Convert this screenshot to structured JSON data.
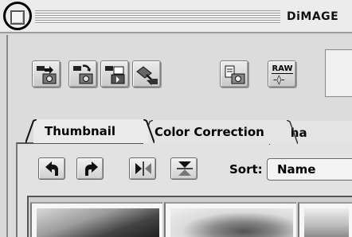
{
  "window": {
    "title": "DiMAGE",
    "close_box_highlighted": true
  },
  "toolbar": {
    "buttons": [
      {
        "icon": "import-scan-icon"
      },
      {
        "icon": "import-camera-icon"
      },
      {
        "icon": "import-folder-icon"
      },
      {
        "icon": "connect-camera-icon"
      },
      {
        "icon": "camera-file-icon"
      },
      {
        "icon": "raw-convert-icon",
        "label": "RAW",
        "sub": "-◊-"
      }
    ]
  },
  "tabs": [
    {
      "label": "Thumbnail",
      "active": true
    },
    {
      "label": "Color Correction",
      "active": false
    },
    {
      "label": "Sha",
      "active": false
    }
  ],
  "thumb_toolbar": {
    "buttons": [
      {
        "icon": "rotate-left-icon"
      },
      {
        "icon": "rotate-right-icon"
      },
      {
        "icon": "flip-horizontal-icon"
      },
      {
        "icon": "flip-vertical-icon"
      }
    ],
    "sort_label": "Sort:",
    "sort_value": "Name"
  },
  "thumbnails": [
    {
      "index": 1
    },
    {
      "index": 2
    },
    {
      "index": 3
    }
  ]
}
